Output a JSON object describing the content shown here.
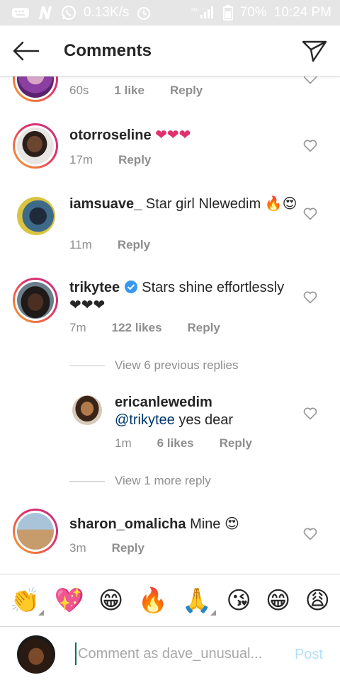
{
  "statusbar": {
    "speed": "0.13K/s",
    "battery": "70%",
    "time": "10:24 PM"
  },
  "header": {
    "title": "Comments"
  },
  "comments": [
    {
      "username": "",
      "text": "",
      "time": "60s",
      "likes": "1 like",
      "reply": "Reply"
    },
    {
      "username": "otorroseline",
      "text": "❤❤❤",
      "time": "17m",
      "reply": "Reply"
    },
    {
      "username": "iamsuave_",
      "text": "Star girl Nlewedim 🔥😍",
      "time": "11m",
      "reply": "Reply"
    },
    {
      "username": "trikytee",
      "text": "Stars shine effortlessly ❤❤❤",
      "time": "7m",
      "likes": "122 likes",
      "reply": "Reply"
    },
    {
      "username": "ericanlewedim",
      "mention": "@trikytee",
      "text": " yes dear",
      "time": "1m",
      "likes": "6 likes",
      "reply": "Reply"
    },
    {
      "username": "sharon_omalicha",
      "text": "Mine 😍",
      "time": "3m",
      "reply": "Reply"
    }
  ],
  "view_previous": "View 6 previous replies",
  "view_more": "View 1 more reply",
  "emoji_bar": [
    "👏",
    "💖",
    "😁",
    "🔥",
    "🙏",
    "😘",
    "😁",
    "😩"
  ],
  "input": {
    "placeholder": "Comment as dave_unusual...",
    "post_label": "Post"
  },
  "colors": {
    "ring_start": "#f9a825",
    "ring_end": "#c13584",
    "link": "#003569",
    "post_disabled": "#b2dffc"
  }
}
